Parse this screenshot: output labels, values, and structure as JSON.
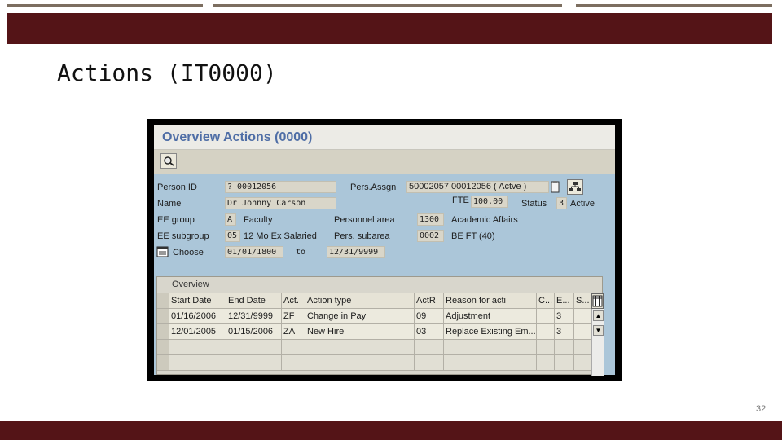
{
  "slide": {
    "title": "Actions (IT0000)",
    "page_number": "32",
    "accent_color": "#541417"
  },
  "window": {
    "title": "Overview Actions (0000)",
    "toolbar_icon": "overview-search-icon"
  },
  "header": {
    "person_id_label": "Person ID",
    "person_id_value": "?_00012056",
    "pers_assgn_label": "Pers.Assgn",
    "pers_assgn_value": "50002057 00012056 ( Actve )",
    "name_label": "Name",
    "name_value": "Dr  Johnny  Carson",
    "fte_label": "FTE",
    "fte_value": "100.00",
    "status_label": "Status",
    "status_value": "3",
    "status_text": "Active",
    "ee_group_label": "EE group",
    "ee_group_value": "A",
    "ee_group_text": "Faculty",
    "personnel_area_label": "Personnel area",
    "personnel_area_value": "1300",
    "personnel_area_text": "Academic Affairs",
    "ee_subgroup_label": "EE subgroup",
    "ee_subgroup_value": "05",
    "ee_subgroup_text": "12 Mo Ex Salaried",
    "pers_subarea_label": "Pers. subarea",
    "pers_subarea_value": "0002",
    "pers_subarea_text": "BE FT (40)",
    "choose_label": "Choose",
    "choose_from": "01/01/1800",
    "to_label": "to",
    "choose_to": "12/31/9999"
  },
  "overview": {
    "label": "Overview",
    "columns": [
      "Start Date",
      "End Date",
      "Act.",
      "Action type",
      "ActR",
      "Reason for acti",
      "C...",
      "E...",
      "S..."
    ],
    "rows": [
      [
        "01/16/2006",
        "12/31/9999",
        "ZF",
        "Change in Pay",
        "09",
        "Adjustment",
        "",
        "3",
        ""
      ],
      [
        "12/01/2005",
        "01/15/2006",
        "ZA",
        "New Hire",
        "03",
        "Replace Existing Em...",
        "",
        "3",
        ""
      ]
    ],
    "scroll_up": "▲",
    "scroll_down": "▼"
  }
}
